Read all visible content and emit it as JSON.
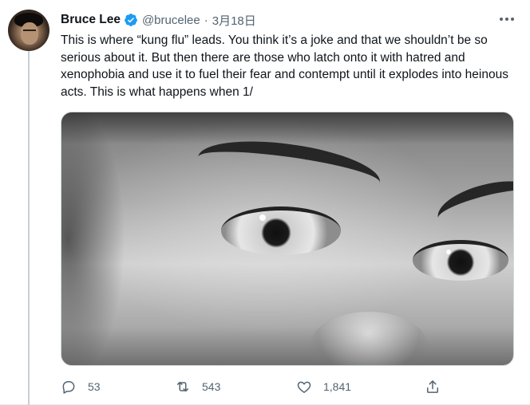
{
  "tweet": {
    "author_name": "Bruce Lee",
    "handle": "@brucelee",
    "separator": "·",
    "date": "3月18日",
    "text": "This is where “kung flu” leads. You think it’s a joke and that we shouldn’t be so serious about it. But then there are those who latch onto it with hatred and xenophobia and use it to fuel their fear and contempt until it explodes into heinous acts. This is what happens when 1/",
    "counts": {
      "replies": "53",
      "retweets": "543",
      "likes": "1,841"
    }
  },
  "icons": {
    "verified": "verified-badge-icon",
    "more": "more-icon",
    "reply": "reply-icon",
    "retweet": "retweet-icon",
    "like": "like-icon",
    "share": "share-icon"
  },
  "colors": {
    "verified": "#1d9bf0",
    "secondary_text": "#536471",
    "thread_line": "#c4cfd6"
  }
}
